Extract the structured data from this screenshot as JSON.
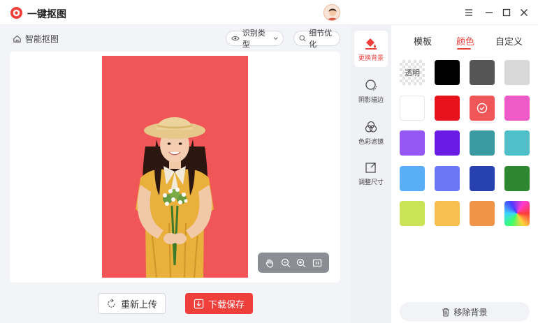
{
  "app": {
    "title": "一键抠图"
  },
  "window": {
    "menu_icon": "menu-icon",
    "min_icon": "minimize-icon",
    "max_icon": "maximize-icon",
    "close_icon": "close-icon"
  },
  "canvas": {
    "breadcrumb": "智能抠图",
    "recognize_type": "识别类型",
    "detail_optimize": "细节优化",
    "background_color": "#f05657"
  },
  "actions": {
    "reupload": "重新上传",
    "download_save": "下载保存"
  },
  "tools": [
    {
      "label": "更换背景",
      "icon": "paint-bucket-icon",
      "active": true
    },
    {
      "label": "阴影描边",
      "icon": "shadow-icon",
      "active": false
    },
    {
      "label": "色彩滤镜",
      "icon": "color-filter-icon",
      "active": false
    },
    {
      "label": "调整尺寸",
      "icon": "resize-icon",
      "active": false
    }
  ],
  "tabs": [
    {
      "label": "模板",
      "active": false
    },
    {
      "label": "颜色",
      "active": true
    },
    {
      "label": "自定义",
      "active": false
    }
  ],
  "swatches": {
    "transparent_label": "透明",
    "colors": [
      "#000000",
      "#555555",
      "#d8d8d8",
      "#ffffff",
      "#e8121c",
      "#f05657",
      "#ee5bc8",
      "#9457f3",
      "#6a1be6",
      "#3b9aa1",
      "#4fbfc9",
      "#5aaef7",
      "#6a77f5",
      "#2741b0",
      "#2d8731",
      "#cbe356",
      "#f7be50",
      "#ef9448"
    ],
    "selected": "#f05657"
  },
  "remove_bg": "移除背景",
  "accent": "#ef3f3a"
}
